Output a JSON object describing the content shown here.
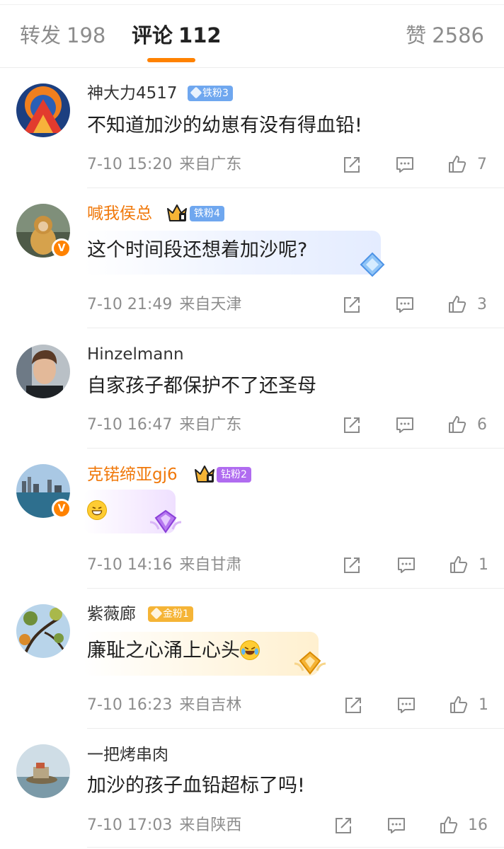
{
  "tabs": {
    "repost": {
      "label": "转发",
      "count": "198"
    },
    "comments": {
      "label": "评论",
      "count": "112"
    },
    "likes": {
      "label": "赞",
      "count": "2586"
    }
  },
  "comments": [
    {
      "user": "神大力4517",
      "badge": "铁粉3",
      "text": "不知道加沙的幼崽有没有得血铅!",
      "time": "7-10 15:20",
      "location": "来自广东",
      "likes": "7"
    },
    {
      "user": "喊我侯总",
      "badge": "铁粉4",
      "text": "这个时间段还想着加沙呢?",
      "time": "7-10 21:49",
      "location": "来自天津",
      "likes": "3"
    },
    {
      "user": "Hinzelmann",
      "badge": "",
      "text": "自家孩子都保护不了还圣母",
      "time": "7-10 16:47",
      "location": "来自广东",
      "likes": "6"
    },
    {
      "user": "克锘缔亚gj6",
      "badge": "钻粉2",
      "text": "",
      "time": "7-10 14:16",
      "location": "来自甘肃",
      "likes": "1"
    },
    {
      "user": "紫薇廊",
      "badge": "金粉1",
      "text": "廉耻之心涌上心头",
      "time": "7-10 16:23",
      "location": "来自吉林",
      "likes": "1"
    },
    {
      "user": "一把烤串肉",
      "badge": "",
      "text": "加沙的孩子血铅超标了吗!",
      "time": "7-10 17:03",
      "location": "来自陕西",
      "likes": "16"
    }
  ],
  "icons": {
    "share": "share-icon",
    "comment": "comment-icon",
    "like": "thumbs-up-icon"
  },
  "colors": {
    "accent": "#ff8200",
    "vip_name": "#f0780a",
    "meta_text": "#8d8d8d"
  }
}
